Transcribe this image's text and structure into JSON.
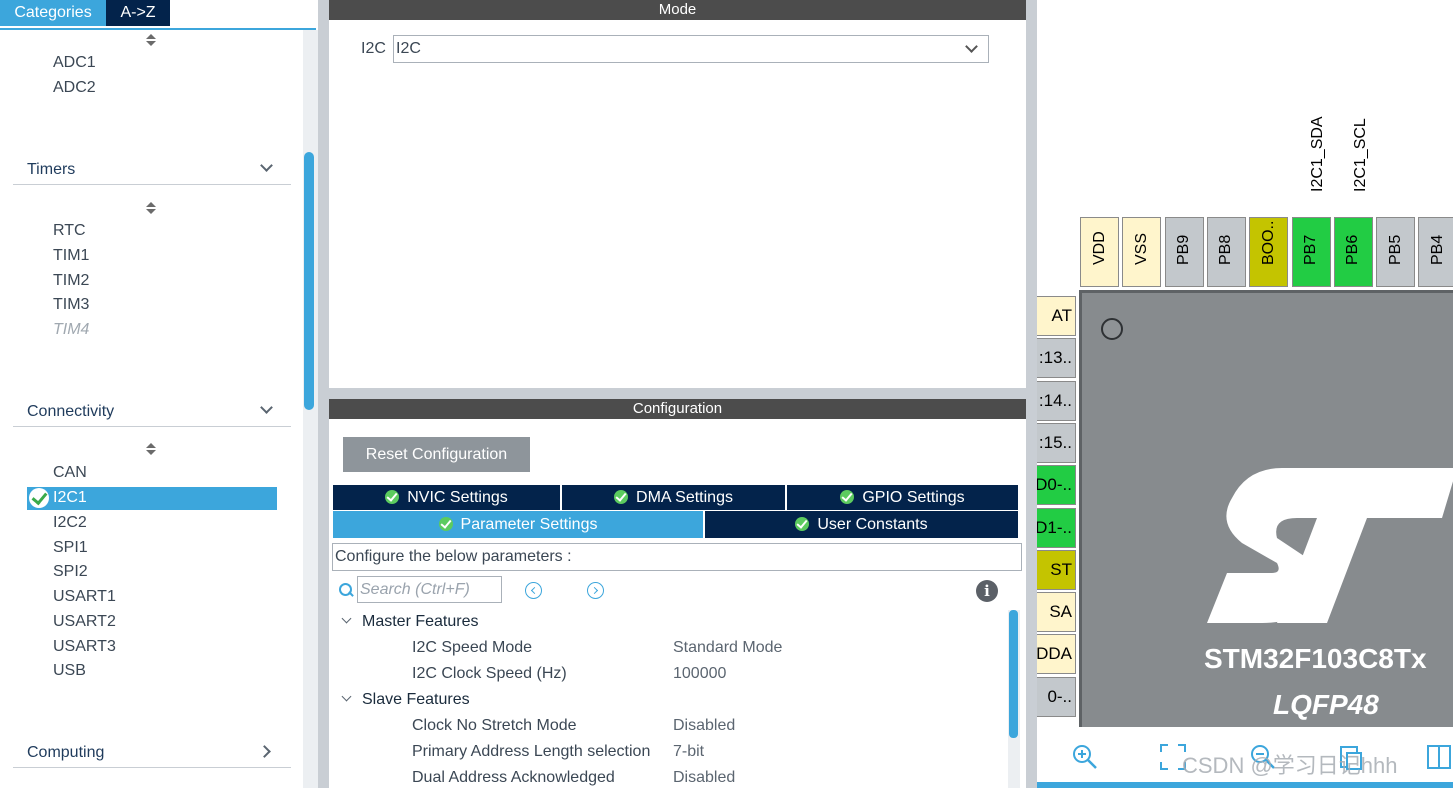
{
  "left_panel": {
    "tabs": {
      "categories": "Categories",
      "az": "A->Z"
    },
    "analog_items": [
      "ADC1",
      "ADC2"
    ],
    "timers": {
      "title": "Timers",
      "items": [
        "RTC",
        "TIM1",
        "TIM2",
        "TIM3"
      ],
      "disabled_item": "TIM4"
    },
    "connectivity": {
      "title": "Connectivity",
      "items": [
        "CAN",
        "I2C1",
        "I2C2",
        "SPI1",
        "SPI2",
        "USART1",
        "USART2",
        "USART3",
        "USB"
      ],
      "selected": "I2C1"
    },
    "computing": {
      "title": "Computing"
    }
  },
  "mode": {
    "header": "Mode",
    "field_label": "I2C",
    "field_value": "I2C"
  },
  "configuration": {
    "header": "Configuration",
    "reset_label": "Reset Configuration",
    "tabs": [
      "NVIC Settings",
      "DMA Settings",
      "GPIO Settings",
      "Parameter Settings",
      "User Constants"
    ],
    "active_tab": "Parameter Settings",
    "hint": "Configure the below parameters :",
    "search_placeholder": "Search (Ctrl+F)",
    "info_glyph": "i",
    "groups": [
      {
        "name": "Master Features",
        "params": [
          {
            "name": "I2C Speed Mode",
            "value": "Standard Mode"
          },
          {
            "name": "I2C Clock Speed (Hz)",
            "value": "100000"
          }
        ]
      },
      {
        "name": "Slave Features",
        "params": [
          {
            "name": "Clock No Stretch Mode",
            "value": "Disabled"
          },
          {
            "name": "Primary Address Length selection",
            "value": "7-bit"
          },
          {
            "name": "Dual Address Acknowledged",
            "value": "Disabled"
          }
        ]
      }
    ]
  },
  "chip": {
    "name": "STM32F103C8Tx",
    "package": "LQFP48",
    "signals": [
      "I2C1_SDA",
      "I2C1_SCL"
    ],
    "top_pins": [
      {
        "label": "VDD",
        "color": "#fff5cc"
      },
      {
        "label": "VSS",
        "color": "#fff5cc"
      },
      {
        "label": "PB9",
        "color": "#c3c8cc"
      },
      {
        "label": "PB8",
        "color": "#c3c8cc"
      },
      {
        "label": "BOO..",
        "color": "#c4c400"
      },
      {
        "label": "PB7",
        "color": "#22cc44"
      },
      {
        "label": "PB6",
        "color": "#22cc44"
      },
      {
        "label": "PB5",
        "color": "#c3c8cc"
      },
      {
        "label": "PB4",
        "color": "#c3c8cc"
      }
    ],
    "left_pins": [
      {
        "label": "AT",
        "color": "#fff5cc"
      },
      {
        "label": ":13..",
        "color": "#c3c8cc"
      },
      {
        "label": ":14..",
        "color": "#c3c8cc"
      },
      {
        "label": ":15..",
        "color": "#c3c8cc"
      },
      {
        "label": "D0-..",
        "color": "#22cc44"
      },
      {
        "label": "D1-..",
        "color": "#22cc44"
      },
      {
        "label": "ST",
        "color": "#c4c400"
      },
      {
        "label": "SA",
        "color": "#fff5cc"
      },
      {
        "label": "DDA",
        "color": "#fff5cc"
      },
      {
        "label": "0-..",
        "color": "#c3c8cc"
      }
    ],
    "watermark": "CSDN @学习日记hhh"
  },
  "colors": {
    "accent": "#3ca6dc",
    "navy": "#03234b",
    "panel_header": "#4c4c4c",
    "pin_active": "#22cc44",
    "pin_boot": "#c4c400",
    "pin_power": "#fff5cc",
    "chip_body": "#878b8e"
  },
  "icons": [
    "sort-icon",
    "chevron-down-icon",
    "chevron-right-icon",
    "check-icon",
    "search-icon",
    "prev-icon",
    "next-icon",
    "info-icon",
    "zoom-in-icon",
    "fit-icon",
    "zoom-out-icon",
    "export-icon"
  ]
}
